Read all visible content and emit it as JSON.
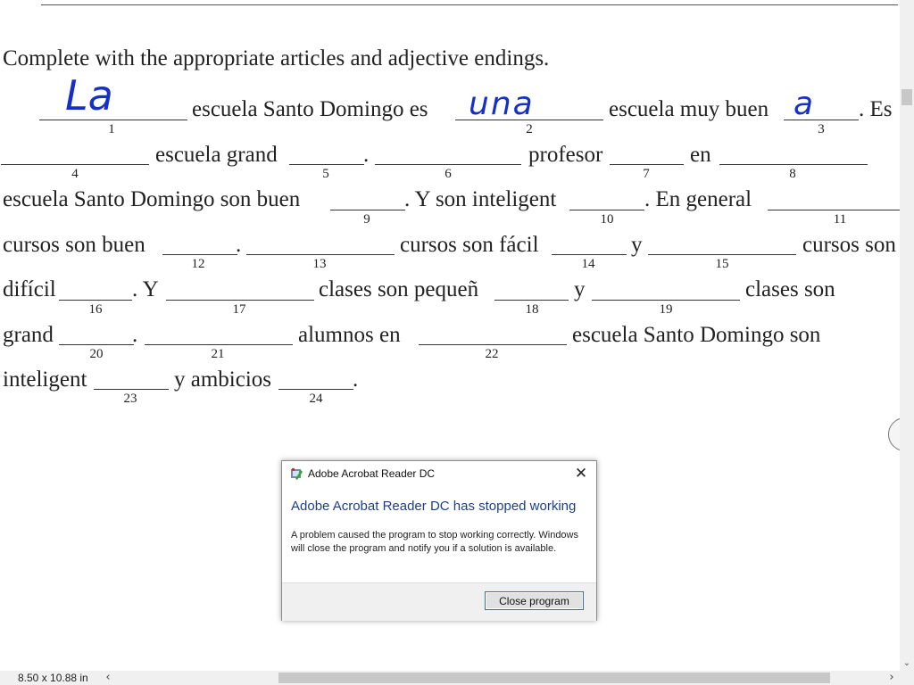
{
  "document": {
    "instruction": "Complete with the appropriate articles and adjective endings.",
    "lines": [
      {
        "segments": [
          "escuela Santo Domingo es",
          "escuela muy buen",
          ". Es"
        ]
      },
      {
        "segments": [
          "escuela grand",
          ".",
          "profesor",
          "en"
        ]
      },
      {
        "segments": [
          "escuela Santo Domingo son buen",
          ". Y son inteligent",
          ". En general"
        ]
      },
      {
        "segments": [
          "cursos son buen",
          ".",
          "cursos son fácil",
          "y",
          "cursos son"
        ]
      },
      {
        "segments": [
          "difícil",
          ". Y",
          "clases son pequeñ",
          "y",
          "clases son"
        ]
      },
      {
        "segments": [
          "grand",
          ".",
          "alumnos en",
          "escuela Santo Domingo son"
        ]
      },
      {
        "segments": [
          "inteligent",
          "y ambicios",
          "."
        ]
      }
    ],
    "blank_numbers": [
      "1",
      "2",
      "3",
      "4",
      "5",
      "6",
      "7",
      "8",
      "9",
      "10",
      "11",
      "12",
      "13",
      "14",
      "15",
      "16",
      "17",
      "18",
      "19",
      "20",
      "21",
      "22",
      "23",
      "24"
    ],
    "handwritten_answers": {
      "blank1": "La",
      "blank2": "una",
      "blank3": "a"
    }
  },
  "statusbar": {
    "page_size": "8.50 x 10.88 in"
  },
  "scrollbars": {
    "left_arrow": "‹",
    "right_arrow": "›",
    "down_arrow": "⌄"
  },
  "dialog": {
    "title": "Adobe Acrobat Reader DC",
    "heading": "Adobe Acrobat Reader DC has stopped working",
    "message": "A problem caused the program to stop working correctly. Windows will close the program and notify you if a solution is available.",
    "close_program_label": "Close program",
    "close_glyph": "✕"
  },
  "icons": {
    "select_tool": "cursor-arrow-icon",
    "app_icon": "acrobat-app-icon"
  },
  "colors": {
    "handwriting": "#1530c8",
    "dialog_heading": "#1d3f8c",
    "button_border": "#2c6fd0"
  }
}
